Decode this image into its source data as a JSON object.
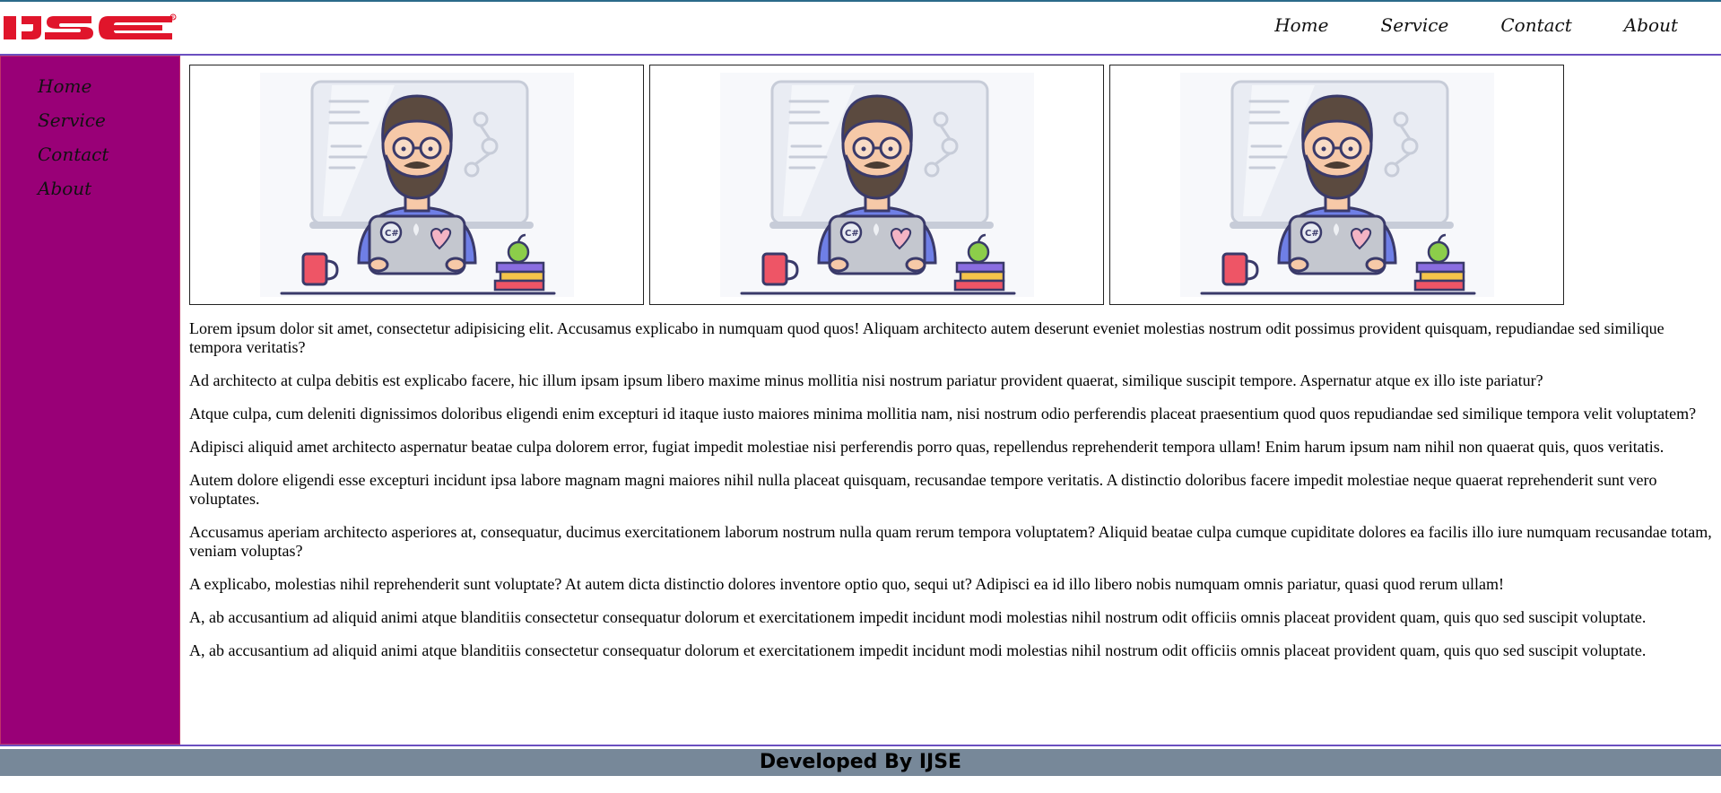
{
  "header": {
    "logo_text": "IJSE",
    "logo_color": "#e0152b",
    "nav": [
      "Home",
      "Service",
      "Contact",
      "About"
    ]
  },
  "sidebar": {
    "bg_color": "#990077",
    "items": [
      "Home",
      "Service",
      "Contact",
      "About"
    ]
  },
  "cards": [
    {
      "image": "developer-illustration"
    },
    {
      "image": "developer-illustration"
    },
    {
      "image": "developer-illustration"
    }
  ],
  "paragraphs": [
    "Lorem ipsum dolor sit amet, consectetur adipisicing elit. Accusamus explicabo in numquam quod quos! Aliquam architecto autem deserunt eveniet molestias nostrum odit possimus provident quisquam, repudiandae sed similique tempora veritatis?",
    "Ad architecto at culpa debitis est explicabo facere, hic illum ipsam ipsum libero maxime minus mollitia nisi nostrum pariatur provident quaerat, similique suscipit tempore. Aspernatur atque ex illo iste pariatur?",
    "Atque culpa, cum deleniti dignissimos doloribus eligendi enim excepturi id itaque iusto maiores minima mollitia nam, nisi nostrum odio perferendis placeat praesentium quod quos repudiandae sed similique tempora velit voluptatem?",
    "Adipisci aliquid amet architecto aspernatur beatae culpa dolorem error, fugiat impedit molestiae nisi perferendis porro quas, repellendus reprehenderit tempora ullam! Enim harum ipsum nam nihil non quaerat quis, quos veritatis.",
    "Autem dolore eligendi esse excepturi incidunt ipsa labore magnam magni maiores nihil nulla placeat quisquam, recusandae tempore veritatis. A distinctio doloribus facere impedit molestiae neque quaerat reprehenderit sunt vero voluptates.",
    "Accusamus aperiam architecto asperiores at, consequatur, ducimus exercitationem laborum nostrum nulla quam rerum tempora voluptatem? Aliquid beatae culpa cumque cupiditate dolores ea facilis illo iure numquam recusandae totam, veniam voluptas?",
    "A explicabo, molestias nihil reprehenderit sunt voluptate? At autem dicta distinctio dolores inventore optio quo, sequi ut? Adipisci ea id illo libero nobis numquam omnis pariatur, quasi quod rerum ullam!",
    "A, ab accusantium ad aliquid animi atque blanditiis consectetur consequatur dolorum et exercitationem impedit incidunt modi molestias nihil nostrum odit officiis omnis placeat provident quam, quis quo sed suscipit voluptate.",
    "A, ab accusantium ad aliquid animi atque blanditiis consectetur consequatur dolorum et exercitationem impedit incidunt modi molestias nihil nostrum odit officiis omnis placeat provident quam, quis quo sed suscipit voluptate."
  ],
  "footer": {
    "text": "Developed By IJSE",
    "bg_color": "#778899"
  }
}
